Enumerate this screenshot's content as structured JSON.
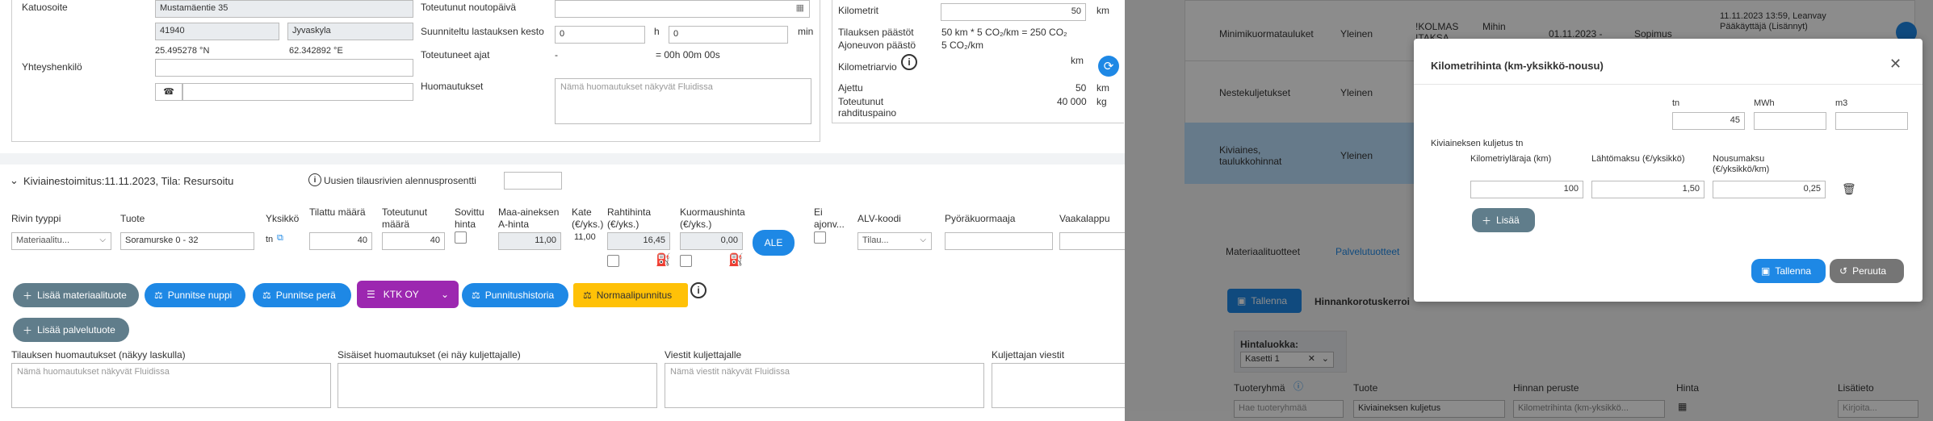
{
  "address": {
    "katuosoite_label": "Katuosoite",
    "street": "Mustamäentie 35",
    "zip": "41940",
    "city": "Jyvaskyla",
    "lat": "25.495278 °N",
    "lon": "62.342892 °E",
    "yhteyshenkilo_label": "Yhteyshenkilö",
    "phone_icon": "phone-icon"
  },
  "schedule": {
    "toteutunut_noutopaiva_label": "Toteutunut noutopäivä",
    "suunniteltu_label": "Suunniteltu lastauksen kesto",
    "hours_value": "0",
    "h_unit": "h",
    "minutes_value": "0",
    "min_unit": "min",
    "toteutuneet_ajat_label": "Toteutuneet ajat",
    "ajat_dash": "-",
    "ajat_value": "= 00h 00m 00s",
    "huomautukset_label": "Huomautukset",
    "huomautukset_placeholder": "Nämä huomautukset näkyvät Fluidissa"
  },
  "km": {
    "kilometrit_label": "Kilometrit",
    "kilometrit_value": "50",
    "km_unit": "km",
    "paastot_label": "Tilauksen päästöt",
    "paastot_value": "50 km * 5 CO₂/km = 250 CO₂",
    "ajoneuvo_label": "Ajoneuvon päästö",
    "ajoneuvo_value": "5 CO₂/km",
    "arvio_label": "Kilometriarvio",
    "arvio_unit": "km",
    "ajettu_label": "Ajettu",
    "ajettu_value": "50",
    "ajettu_unit": "km",
    "rahtipaino_label1": "Toteutunut",
    "rahtipaino_label2": "rahdituspaino",
    "rahtipaino_value": "40 000",
    "rahtipaino_unit": "kg"
  },
  "delivery": {
    "header": "Kiviainestoimitus:11.11.2023, Tila: Resursoitu",
    "discount_label": "Uusien tilausrivien alennusprosentti",
    "columns": {
      "rivin_tyyppi": "Rivin tyyppi",
      "tuote": "Tuote",
      "yksikko": "Yksikkö",
      "tilattu1": "Tilattu määrä",
      "toteutunut1": "Toteutunut",
      "toteutunut2": "määrä",
      "sovittu1": "Sovittu",
      "sovittu2": "hinta",
      "maa1": "Maa-aineksen",
      "maa2": "A-hinta",
      "kate1": "Kate",
      "kate2": "(€/yks.)",
      "rahti1": "Rahtihinta",
      "rahti2": "(€/yks.)",
      "kuorma1": "Kuormaushinta",
      "kuorma2": "(€/yks.)",
      "ei1": "Ei",
      "ei2": "ajonv...",
      "alv": "ALV-koodi",
      "pyora": "Pyöräkuormaaja",
      "vaaka": "Vaakalappu"
    },
    "row": {
      "tyyppi": "Materiaalitu...",
      "tuote": "Soramurske 0 - 32",
      "yksikko": "tn",
      "tilattu": "40",
      "toteutunut": "40",
      "maa_hinta": "11,00",
      "kate": "11,00",
      "rahti": "16,45",
      "kuorma": "0,00",
      "ale": "ALE",
      "alv": "Tilau..."
    }
  },
  "actions": {
    "lisaa_materiaalituote": "Lisää materiaalituote",
    "punnitse_nuppi": "Punnitse nuppi",
    "punnitse_pera": "Punnitse perä",
    "ktk_oy": "KTK OY",
    "punnitushistoria": "Punnitushistoria",
    "normaalipunnitus": "Normaalipunnitus",
    "lisaa_palvelutuote": "Lisää palvelutuote"
  },
  "notes": {
    "tilauksen_label": "Tilauksen huomautukset (näkyy laskulla)",
    "tilauksen_placeholder": "Nämä huomautukset näkyvät Fluidissa",
    "sisaiset_label": "Sisäiset huomautukset (ei näy kuljettajalle)",
    "viestit_label": "Viestit kuljettajalle",
    "viestit_placeholder": "Nämä viestit näkyvät Fluidissa",
    "kuljettajan_label": "Kuljettajan viestit"
  },
  "background_table": {
    "rows": [
      {
        "name": "Minimikuormatauluket",
        "type": "Yleinen",
        "c3": "!KOLMAS",
        "c3b": "!TAKSA",
        "c4": "Mihin",
        "c4b": "...",
        "date": "01.11.2023 -",
        "c6": "Sopimus",
        "info1": "11.11.2023 13:59, Leanvay",
        "info2": "Pääkäyttäjä (Lisännyt)"
      },
      {
        "name": "Nestekuljetukset",
        "type": "Yleinen"
      },
      {
        "name": "Kiviaines,",
        "name2": "taulukkohinnat",
        "type": "Yleinen"
      }
    ],
    "tabs": [
      "Materiaalituotteet",
      "Palvelutuotteet"
    ],
    "tallenna": "Tallenna",
    "hinnankorotus": "Hinnankorotuskerroi",
    "hintaluokka_label": "Hintaluokka:",
    "hintaluokka_value": "Kasetti 1",
    "cols": [
      "Tuoteryhmä",
      "Tuote",
      "Hinnan peruste",
      "Hinta",
      "Lisätieto"
    ],
    "row_tuoteryhma_placeholder": "Hae tuoteryhmää",
    "row_tuote": "Kiviaineksen kuljetus",
    "row_peruste": "Kilometrihinta (km-yksikkö...",
    "row_lisatieto_placeholder": "Kirjoita..."
  },
  "modal": {
    "title": "Kilometrihinta (km-yksikkö-nousu)",
    "unit_tn": "tn",
    "unit_mwh": "MWh",
    "unit_m3": "m3",
    "tn_value": "45",
    "section_label": "Kiviaineksen kuljetus tn",
    "col_raja": "Kilometriyläraja (km)",
    "col_lahto": "Lähtömaksu (€/yksikkö)",
    "col_nousu1": "Nousumaksu",
    "col_nousu2": "(€/yksikkö/km)",
    "raja_value": "100",
    "lahto_value": "1,50",
    "nousu_value": "0,25",
    "lisaa": "Lisää",
    "tallenna": "Tallenna",
    "peruuta": "Peruuta"
  },
  "colors": {
    "primary": "#1e88e5",
    "gray": "#607d8b",
    "purple": "#9c27b0",
    "yellow": "#ffc107"
  }
}
